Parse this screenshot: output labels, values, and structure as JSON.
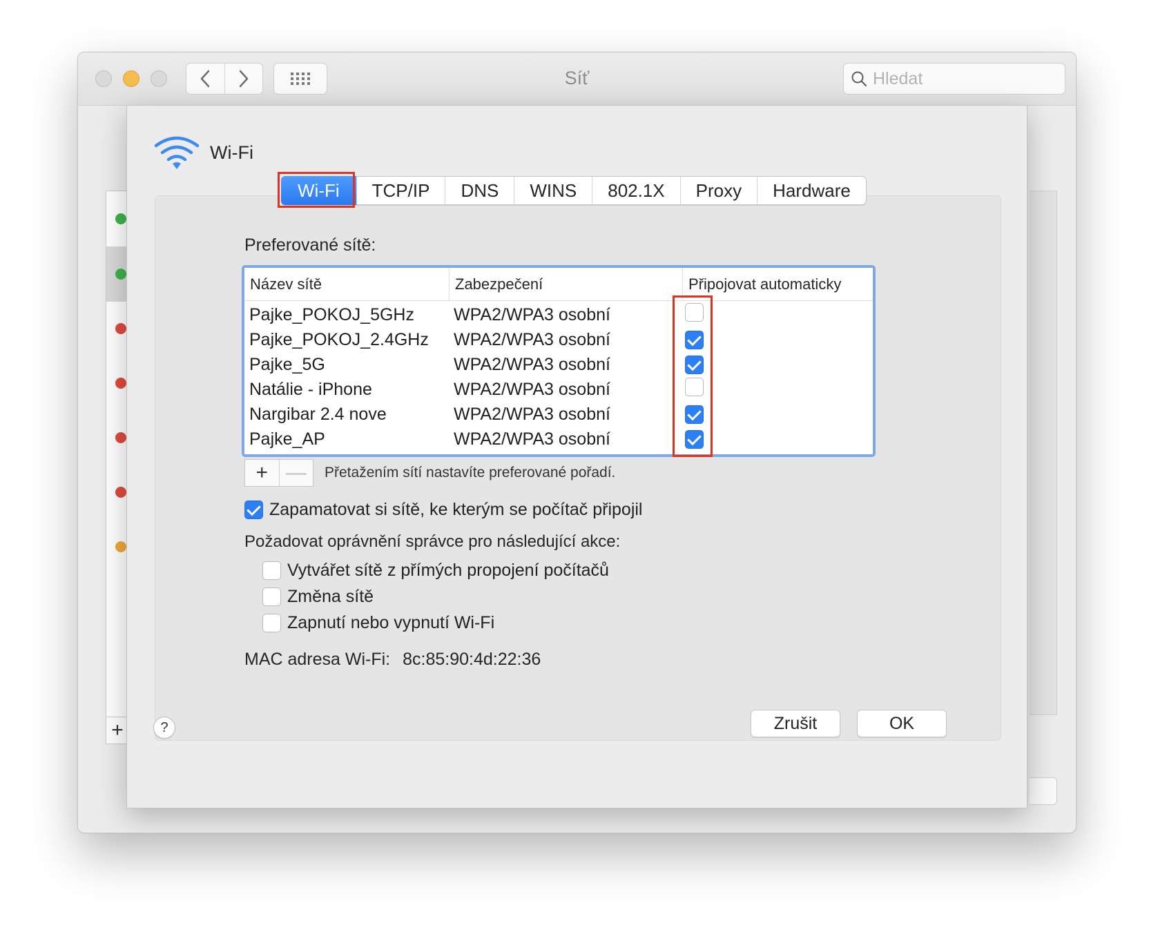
{
  "window": {
    "title": "Síť",
    "search_placeholder": "Hledat"
  },
  "sheet": {
    "service_name": "Wi-Fi",
    "tabs": [
      {
        "label": "Wi-Fi",
        "active": true
      },
      {
        "label": "TCP/IP",
        "active": false
      },
      {
        "label": "DNS",
        "active": false
      },
      {
        "label": "WINS",
        "active": false
      },
      {
        "label": "802.1X",
        "active": false
      },
      {
        "label": "Proxy",
        "active": false
      },
      {
        "label": "Hardware",
        "active": false
      }
    ],
    "preferred_label": "Preferované sítě:",
    "table": {
      "columns": [
        "Název sítě",
        "Zabezpečení",
        "Připojovat automaticky"
      ],
      "rows": [
        {
          "name": "Pajke_POKOJ_5GHz",
          "security": "WPA2/WPA3 osobní",
          "auto": false
        },
        {
          "name": "Pajke_POKOJ_2.4GHz",
          "security": "WPA2/WPA3 osobní",
          "auto": true
        },
        {
          "name": "Pajke_5G",
          "security": "WPA2/WPA3 osobní",
          "auto": true
        },
        {
          "name": "Natálie - iPhone",
          "security": "WPA2/WPA3 osobní",
          "auto": false
        },
        {
          "name": "Nargibar 2.4 nove",
          "security": "WPA2/WPA3 osobní",
          "auto": true
        },
        {
          "name": "Pajke_AP",
          "security": "WPA2/WPA3 osobní",
          "auto": true
        }
      ]
    },
    "add_label": "+",
    "remove_label": "—",
    "drag_hint": "Přetažením sítí nastavíte preferované pořadí.",
    "remember_label": "Zapamatovat si sítě, ke kterým se počítač připojil",
    "remember_checked": true,
    "require_admin_label": "Požadovat oprávnění správce pro následující akce:",
    "admin_options": [
      {
        "label": "Vytvářet sítě z přímých propojení počítačů",
        "checked": false
      },
      {
        "label": "Změna sítě",
        "checked": false
      },
      {
        "label": "Zapnutí nebo vypnutí Wi-Fi",
        "checked": false
      }
    ],
    "mac_label": "MAC adresa Wi-Fi:",
    "mac_value": "8c:85:90:4d:22:36",
    "help_label": "?",
    "cancel_label": "Zrušit",
    "ok_label": "OK"
  },
  "colors": {
    "accent": "#2d7ff6",
    "highlight_box": "#e0321f",
    "status_dots": [
      "#3fb24a",
      "#3fb24a",
      "#e04b3f",
      "#e04b3f",
      "#e04b3f",
      "#e04b3f",
      "#f0a93a"
    ]
  }
}
